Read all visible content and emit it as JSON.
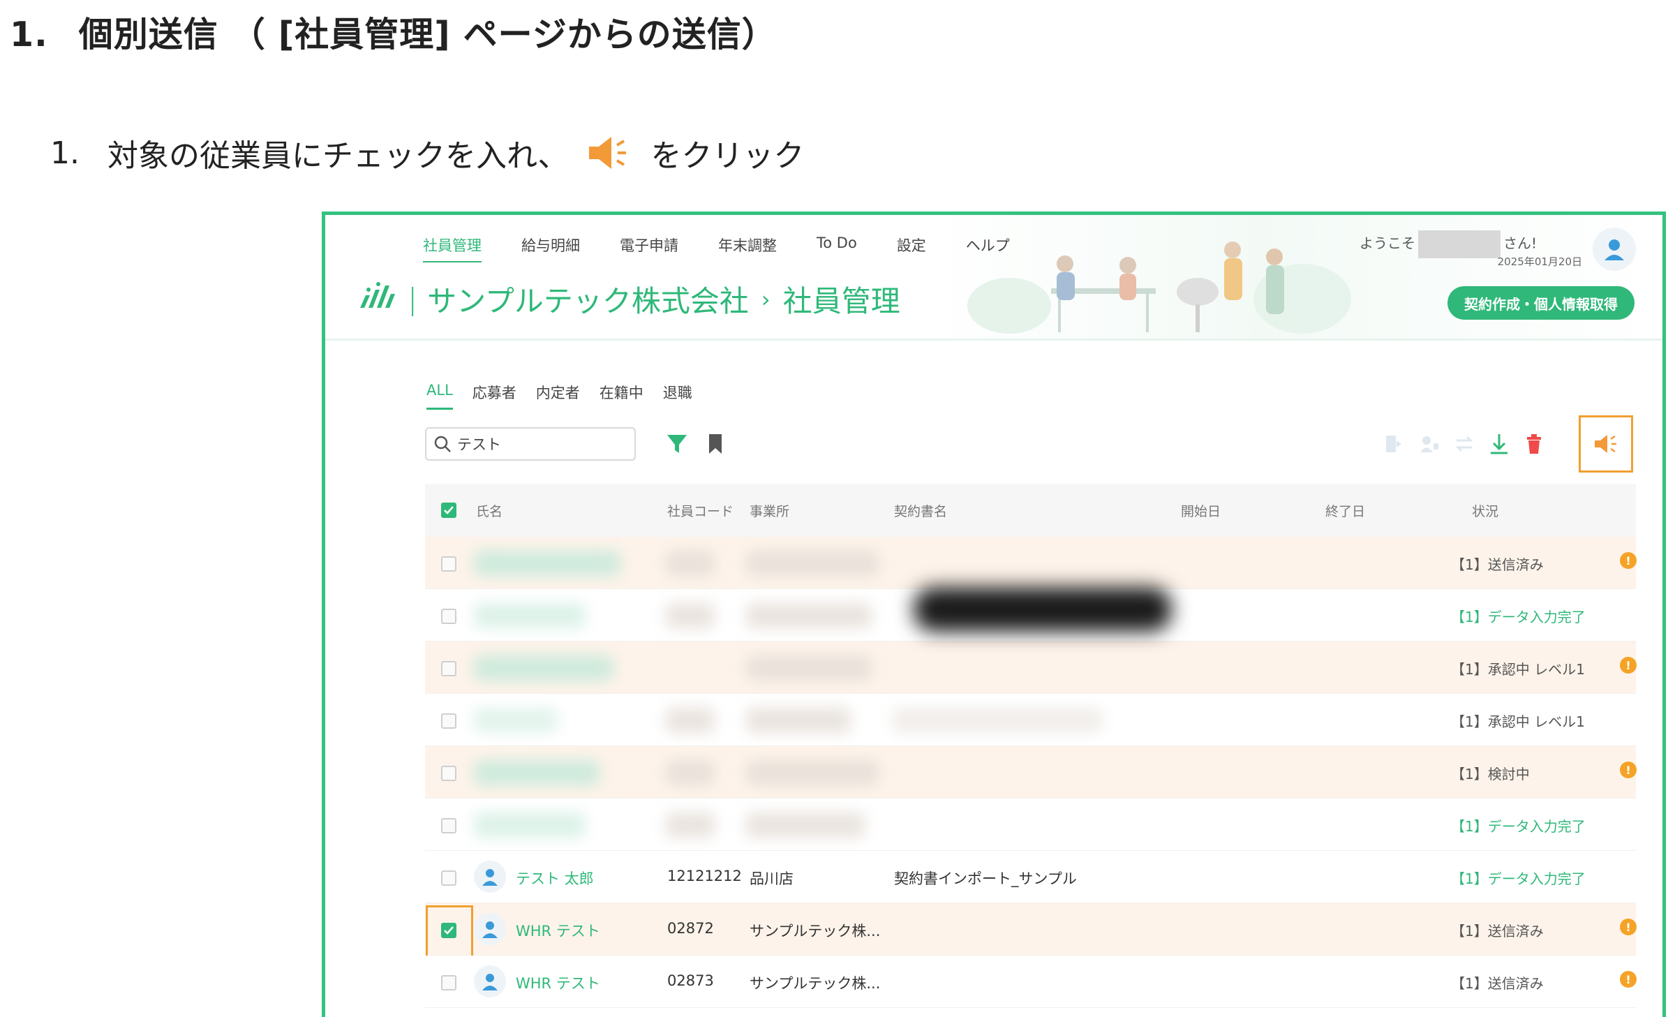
{
  "doc": {
    "heading_num": "1.",
    "heading_text": "個別送信 （ [社員管理] ページからの送信）",
    "step_num": "1.",
    "step_before": "対象の従業員にチェックを入れ、",
    "step_after": "をクリック"
  },
  "app": {
    "nav": [
      "社員管理",
      "給与明細",
      "電子申請",
      "年末調整",
      "To Do",
      "設定",
      "ヘルプ"
    ],
    "company": "サンプルテック株式会社",
    "page": "社員管理",
    "welcome_prefix": "ようこそ",
    "welcome_suffix": "さん!",
    "date": "2025年01月20日",
    "contract_button": "契約作成・個人情報取得",
    "tabs": [
      "ALL",
      "応募者",
      "内定者",
      "在籍中",
      "退職"
    ],
    "search_value": "テスト",
    "colors": {
      "accent": "#2fb879",
      "highlight": "#f0a030",
      "row_tint": "#fdf3ea",
      "warning": "#f5a327"
    },
    "table": {
      "headers": [
        "氏名",
        "社員コード",
        "事業所",
        "契約書名",
        "開始日",
        "終了日",
        "状況"
      ],
      "rows": [
        {
          "name": "",
          "code": "",
          "office": "",
          "contract": "",
          "status": "【1】送信済み",
          "warn": true,
          "checked": false
        },
        {
          "name": "",
          "code": "",
          "office": "",
          "contract": "",
          "status": "【1】データ入力完了",
          "warn": false,
          "checked": false
        },
        {
          "name": "",
          "code": "",
          "office": "",
          "contract": "",
          "status": "【1】承認中 レベル1",
          "warn": true,
          "checked": false
        },
        {
          "name": "",
          "code": "",
          "office": "",
          "contract": "",
          "status": "【1】承認中 レベル1",
          "warn": false,
          "checked": false
        },
        {
          "name": "",
          "code": "",
          "office": "",
          "contract": "",
          "status": "【1】検討中",
          "warn": true,
          "checked": false
        },
        {
          "name": "",
          "code": "",
          "office": "",
          "contract": "",
          "status": "【1】データ入力完了",
          "warn": false,
          "checked": false
        },
        {
          "name": "テスト 太郎",
          "code": "12121212",
          "office": "品川店",
          "contract": "契約書インポート_サンプル",
          "status": "【1】データ入力完了",
          "warn": false,
          "checked": false
        },
        {
          "name": "WHR テスト",
          "code": "02872",
          "office": "サンプルテック株...",
          "contract": "",
          "status": "【1】送信済み",
          "warn": true,
          "checked": true
        },
        {
          "name": "WHR テスト",
          "code": "02873",
          "office": "サンプルテック株...",
          "contract": "",
          "status": "【1】送信済み",
          "warn": true,
          "checked": false
        }
      ]
    },
    "warn_mark": "!"
  }
}
